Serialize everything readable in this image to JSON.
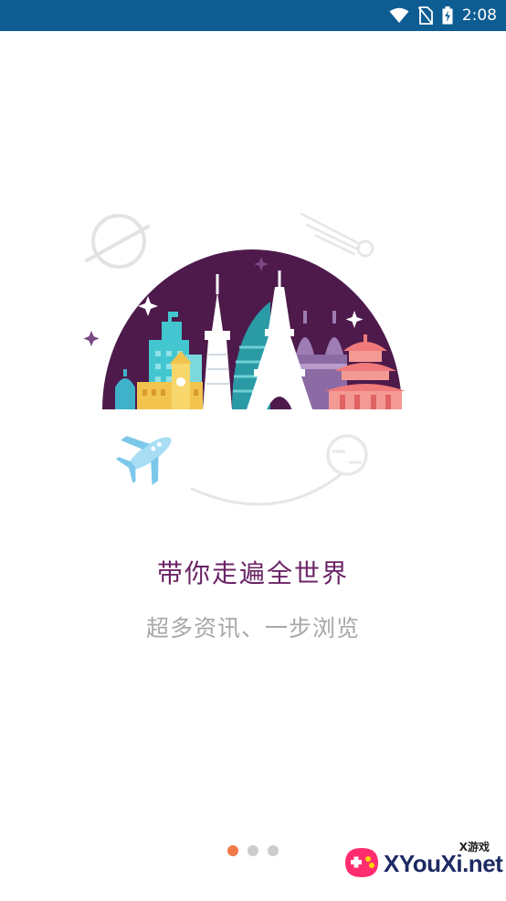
{
  "status_bar": {
    "time": "2:08",
    "icons": [
      "wifi-icon",
      "no-sim-icon",
      "battery-charging-icon"
    ],
    "background": "#0d5c92"
  },
  "onboarding": {
    "headline": "带你走遍全世界",
    "subline": "超多资讯、一步浏览",
    "page_count": 3,
    "current_page": 1
  },
  "colors": {
    "accent": "#6b2466",
    "sky": "#4d1a4b",
    "dot_active": "#f07a4a",
    "dot_inactive": "#cccccc"
  },
  "watermark": {
    "small_text": "X游戏",
    "main_text": "XYouXi.net"
  }
}
